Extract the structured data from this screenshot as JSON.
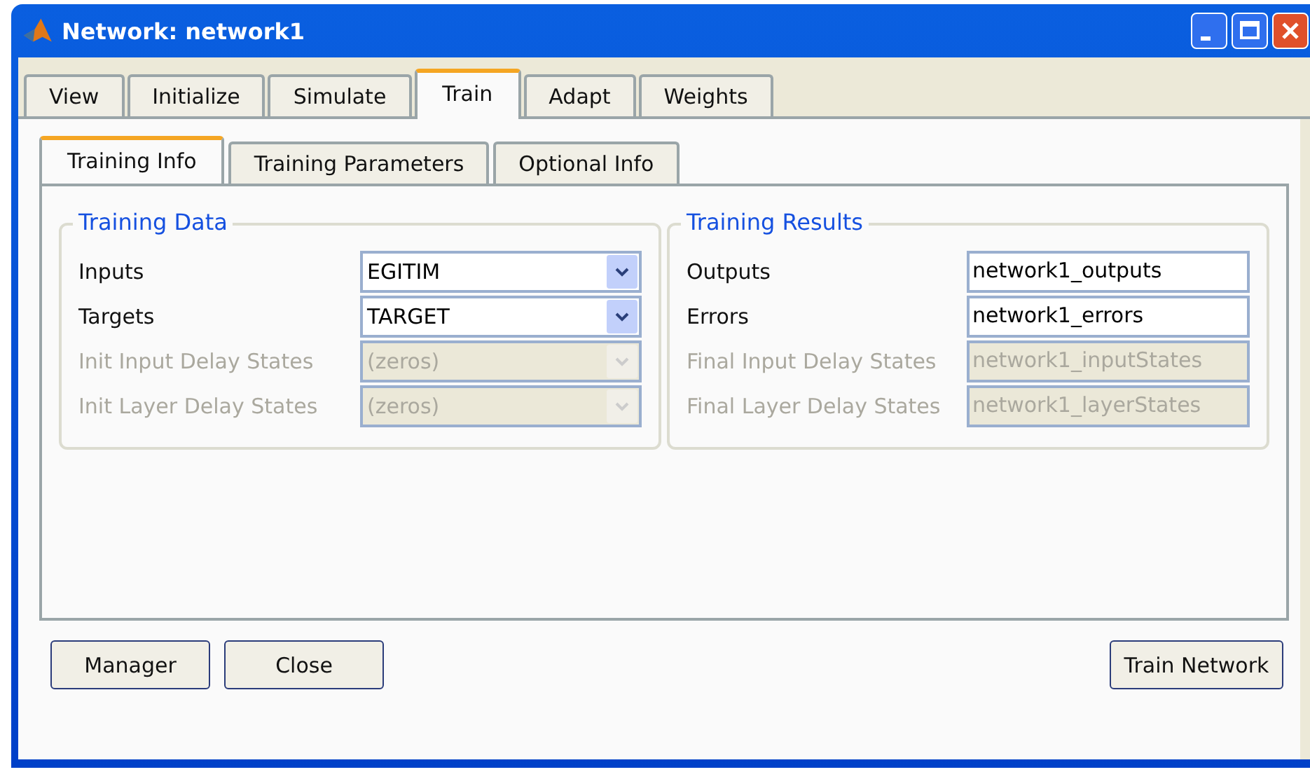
{
  "window": {
    "title": "Network: network1"
  },
  "tabs": [
    {
      "label": "View",
      "selected": false
    },
    {
      "label": "Initialize",
      "selected": false
    },
    {
      "label": "Simulate",
      "selected": false
    },
    {
      "label": "Train",
      "selected": true
    },
    {
      "label": "Adapt",
      "selected": false
    },
    {
      "label": "Weights",
      "selected": false
    }
  ],
  "subtabs": [
    {
      "label": "Training Info",
      "selected": true
    },
    {
      "label": "Training Parameters",
      "selected": false
    },
    {
      "label": "Optional Info",
      "selected": false
    }
  ],
  "groups": [
    {
      "title": "Training Data",
      "rows": [
        {
          "label": "Inputs",
          "value": "EGITIM",
          "kind": "combo",
          "disabled": false
        },
        {
          "label": "Targets",
          "value": "TARGET",
          "kind": "combo",
          "disabled": false
        },
        {
          "label": "Init Input Delay States",
          "value": "(zeros)",
          "kind": "combo",
          "disabled": true
        },
        {
          "label": "Init Layer Delay States",
          "value": "(zeros)",
          "kind": "combo",
          "disabled": true
        }
      ]
    },
    {
      "title": "Training Results",
      "rows": [
        {
          "label": "Outputs",
          "value": "network1_outputs",
          "kind": "text",
          "disabled": false
        },
        {
          "label": "Errors",
          "value": "network1_errors",
          "kind": "text",
          "disabled": false
        },
        {
          "label": "Final Input Delay States",
          "value": "network1_inputStates",
          "kind": "text",
          "disabled": true
        },
        {
          "label": "Final Layer Delay States",
          "value": "network1_layerStates",
          "kind": "text",
          "disabled": true
        }
      ]
    }
  ],
  "buttons_left": [
    "Manager",
    "Close"
  ],
  "button_right": "Train Network"
}
